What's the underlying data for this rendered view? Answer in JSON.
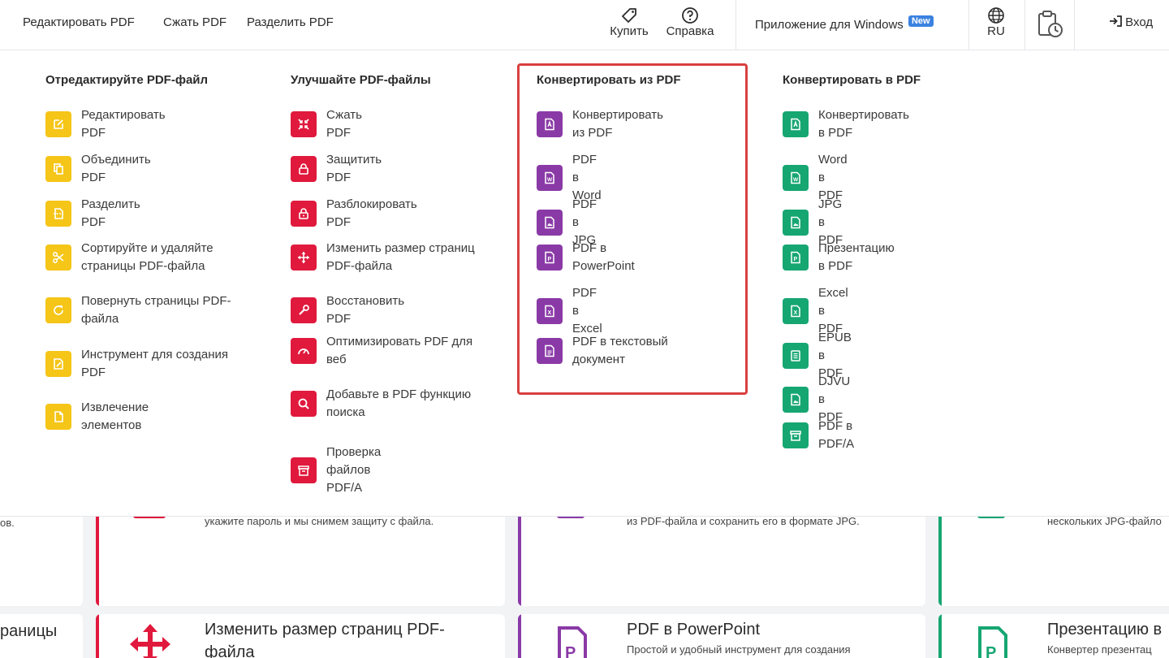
{
  "topbar": {
    "nav": [
      "Редактировать PDF",
      "Сжать PDF",
      "Разделить PDF"
    ],
    "buy": "Купить",
    "help": "Справка",
    "windows_app": "Приложение для Windows",
    "new_badge": "New",
    "language": "RU",
    "login": "Вход"
  },
  "columns": [
    {
      "title": "Отредактируйте PDF-файл",
      "items": [
        "Редактировать PDF",
        "Объединить PDF",
        "Разделить PDF",
        "Сортируйте и удаляйте страницы PDF-файла",
        "Повернуть страницы PDF-файла",
        "Инструмент для создания PDF",
        "Извлечение элементов"
      ]
    },
    {
      "title": "Улучшайте PDF-файлы",
      "items": [
        "Сжать PDF",
        "Защитить PDF",
        "Разблокировать PDF",
        "Изменить размер страниц PDF-файла",
        "Восстановить PDF",
        "Оптимизировать PDF для веб",
        "Добавьте в PDF функцию поиска",
        "Проверка файлов PDF/A"
      ]
    },
    {
      "title": "Конвертировать из PDF",
      "items": [
        "Конвертировать из PDF",
        "PDF в Word",
        "PDF в JPG",
        "PDF в PowerPoint",
        "PDF в Excel",
        "PDF в текстовый документ"
      ]
    },
    {
      "title": "Конвертировать в PDF",
      "items": [
        "Конвертировать в PDF",
        "Word в PDF",
        "JPG в PDF",
        "Презентацию в PDF",
        "Excel в PDF",
        "EPUB в PDF",
        "DJVU в PDF",
        "PDF в PDF/A"
      ]
    }
  ],
  "background_cards": {
    "c1_desc": "ов.",
    "c2_desc": "укажите пароль и мы снимем защиту с файла.",
    "c3_desc": "из PDF-файла и сохранить его в формате JPG.",
    "c4_desc": "нескольких JPG-файло",
    "r2c1_title": "раницы",
    "r2c2_title": "Изменить размер страниц PDF-",
    "r2c2_title2": "файла",
    "r2c3_title": "PDF в PowerPoint",
    "r2c3_desc": "Простой и удобный инструмент для создания",
    "r2c4_title": "Презентацию в",
    "r2c4_desc": "Конвертер презентац"
  },
  "colors": {
    "yellow": "#f5c518",
    "red": "#e0193d",
    "purple": "#8a3aa6",
    "green": "#16a672",
    "highlight": "#d94040",
    "new_badge": "#3b82e0"
  }
}
